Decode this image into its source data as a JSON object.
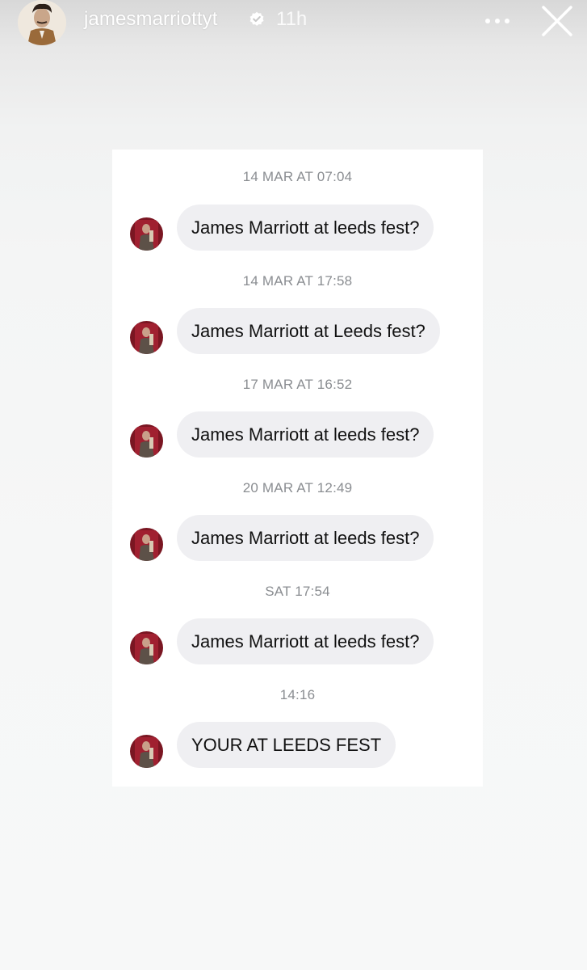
{
  "header": {
    "username": "jamesmarriottyt",
    "time_ago": "11h",
    "verified": true,
    "icons": [
      "avatar",
      "verified-badge-icon",
      "more-icon",
      "close-icon"
    ]
  },
  "messages": [
    {
      "timestamp": "14 MAR AT 07:04",
      "text": "James Marriott at leeds fest?"
    },
    {
      "timestamp": "14 MAR AT 17:58",
      "text": "James Marriott at Leeds fest?"
    },
    {
      "timestamp": "17 MAR AT 16:52",
      "text": "James Marriott at leeds fest?"
    },
    {
      "timestamp": "20 MAR AT 12:49",
      "text": "James Marriott at leeds fest?"
    },
    {
      "timestamp": "SAT 17:54",
      "text": "James Marriott at leeds fest?"
    },
    {
      "timestamp": "14:16",
      "text": "YOUR AT LEEDS FEST"
    }
  ],
  "colors": {
    "bubble": "#efeff2",
    "timestamp": "#8a8d91",
    "message_text": "#111111",
    "card": "#ffffff"
  }
}
